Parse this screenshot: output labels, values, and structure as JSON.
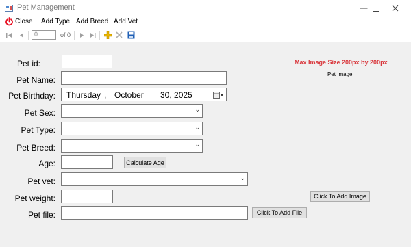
{
  "window": {
    "title": "Pet Management",
    "icon": "app-icon",
    "controls": [
      "minimize-icon",
      "maximize-icon",
      "close-icon"
    ]
  },
  "menu": {
    "close_label": "Close",
    "add_type_label": "Add Type",
    "add_breed_label": "Add Breed",
    "add_vet_label": "Add Vet"
  },
  "navigator": {
    "position_value": "0",
    "of_label": "of 0"
  },
  "info": {
    "max_image_size": "Max Image Size 200px by 200px",
    "pet_image_label": "Pet Image:"
  },
  "form": {
    "pet_id_label": "Pet id:",
    "pet_name_label": "Pet Name:",
    "pet_birthday_label": "Pet Birthday:",
    "pet_sex_label": "Pet Sex:",
    "pet_type_label": "Pet Type:",
    "pet_breed_label": "Pet Breed:",
    "age_label": "Age:",
    "pet_vet_label": "Pet vet:",
    "pet_weight_label": "Pet weight:",
    "pet_file_label": "Pet file:",
    "birthday": {
      "day": "Thursday",
      "comma": ",",
      "month": "October",
      "date": "30, 2025"
    }
  },
  "buttons": {
    "calculate_age": "Calculate Age",
    "add_image": "Click To Add Image",
    "add_file": "Click To Add File"
  },
  "colors": {
    "accent_red": "#d9373c",
    "close_red": "#e81123",
    "textbox_focus_blue": "#0078d7",
    "add_icon_yellow": "#e8b400",
    "save_icon_blue": "#1f5fb5"
  }
}
